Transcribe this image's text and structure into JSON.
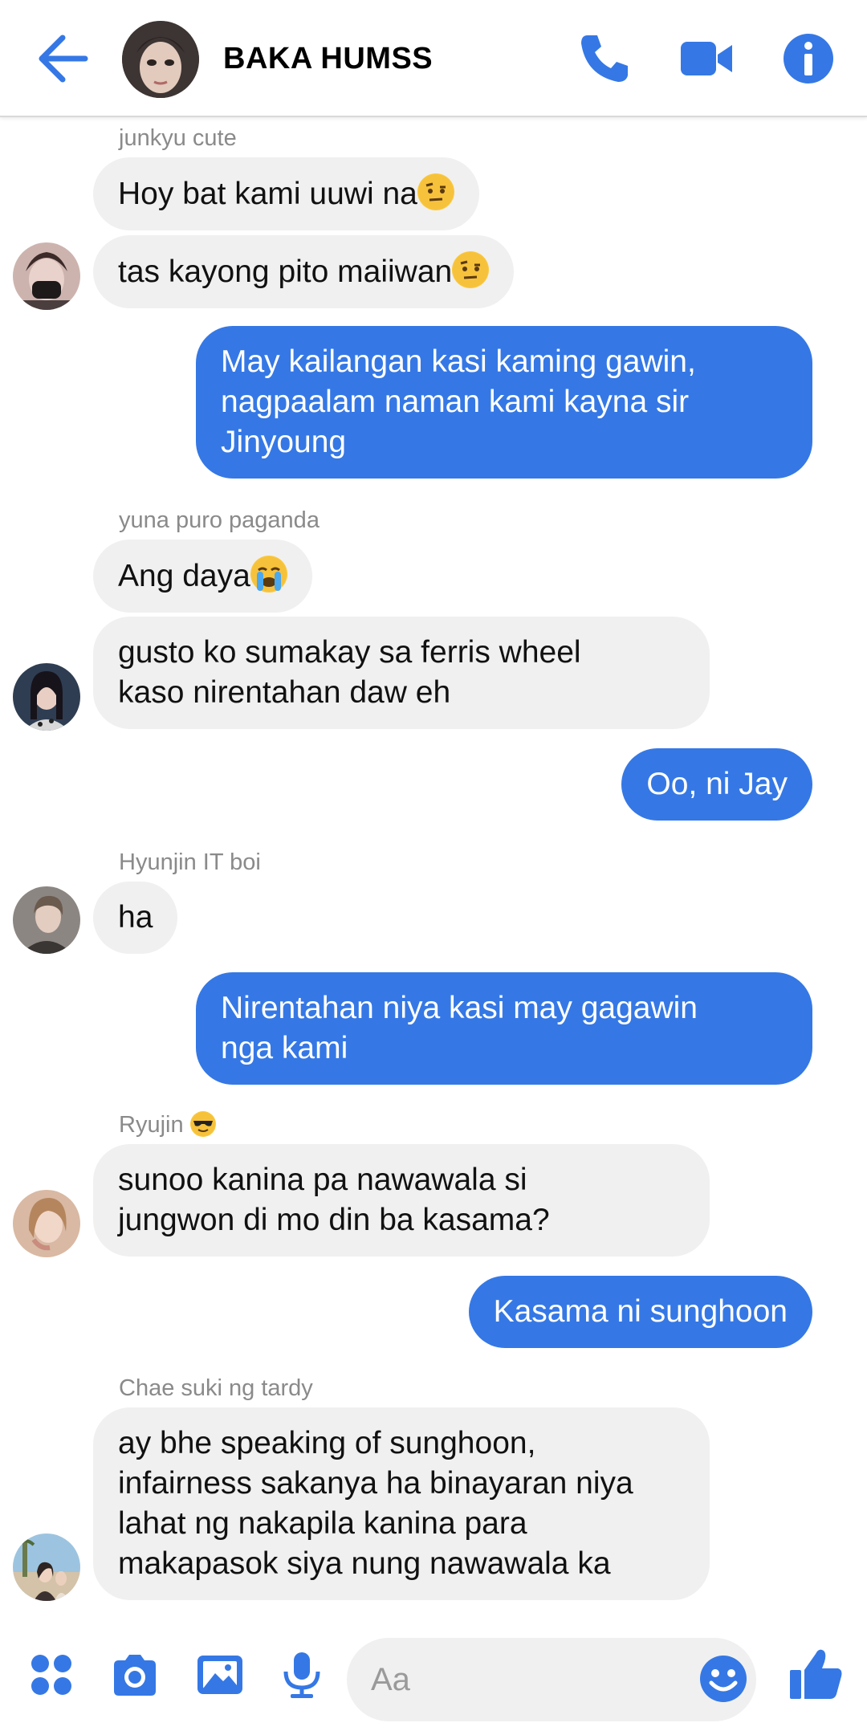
{
  "header": {
    "title": "BAKA HUMSS",
    "icons": [
      "back-arrow-icon",
      "phone-icon",
      "video-camera-icon",
      "info-icon"
    ]
  },
  "colors": {
    "accent": "#3578e5",
    "incoming_bubble": "#f0f0f0",
    "sender_name": "#8a8a8a"
  },
  "messages": {
    "m1": {
      "sender": "junkyu cute",
      "line1": "Hoy bat kami uuwi na",
      "line2": "tas kayong pito maiiwan"
    },
    "m2": {
      "text": "May kailangan kasi kaming gawin,\nnagpaalam naman kami kayna sir\nJinyoung"
    },
    "m3": {
      "sender": "yuna puro paganda",
      "line1": "Ang daya",
      "line2": "gusto ko sumakay sa ferris wheel\nkaso nirentahan daw eh"
    },
    "m4": {
      "text": "Oo, ni Jay"
    },
    "m5": {
      "sender": "Hyunjin IT boi",
      "line1": "ha"
    },
    "m6": {
      "text": "Nirentahan niya kasi may gagawin\nnga kami"
    },
    "m7": {
      "sender": "Ryujin",
      "line1": "sunoo kanina pa nawawala si\njungwon di mo din ba kasama?"
    },
    "m8": {
      "text": "Kasama ni sunghoon"
    },
    "m9": {
      "sender": "Chae suki ng tardy",
      "line1": "ay bhe speaking of sunghoon,\ninfairness sakanya ha binayaran niya\nlahat ng nakapila kanina para\nmakapasok siya nung nawawala ka"
    }
  },
  "composer": {
    "placeholder": "Aa",
    "icons": [
      "apps-grid-icon",
      "camera-icon",
      "image-icon",
      "microphone-icon",
      "emoji-icon",
      "thumbs-up-icon"
    ]
  }
}
